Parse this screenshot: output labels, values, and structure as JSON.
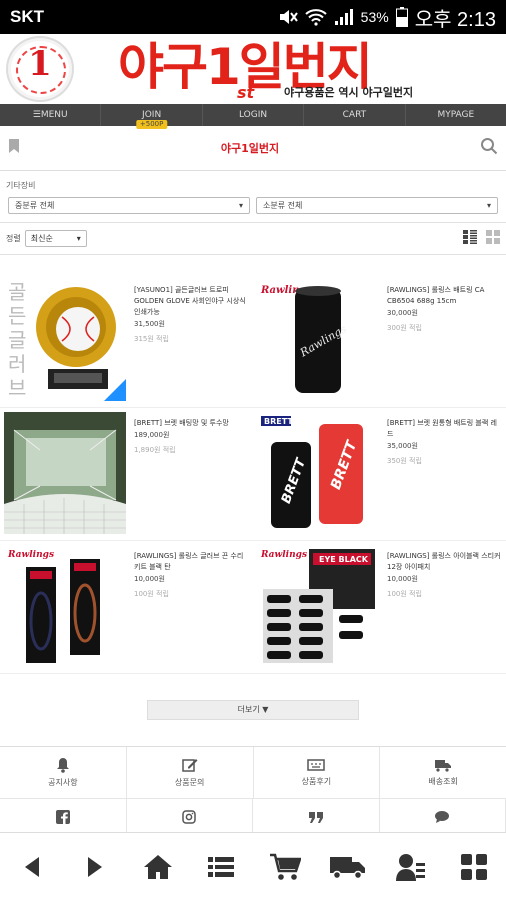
{
  "status_bar": {
    "carrier": "SKT",
    "battery_percent": "53%",
    "time": "오후 2:13"
  },
  "banner": {
    "logo_number": "1",
    "brand_text": "야구1일번지",
    "brand_superscript": "st",
    "slogan": "야구용품은 역시 야구일번지"
  },
  "nav": {
    "menu": "☰MENU",
    "join": "JOIN",
    "join_badge": "+500P",
    "login": "LOGIN",
    "cart": "CART",
    "mypage": "MYPAGE"
  },
  "subhead": {
    "logo_text": "야구1일번지"
  },
  "breadcrumb": "기타장비",
  "filters": {
    "category_medium": "중분류 전체",
    "category_small": "소분류 전체"
  },
  "sort": {
    "label": "정렬",
    "selected": "최신순"
  },
  "products": [
    {
      "name": "[YASUNO1] 골든글러브 트로피 GOLDEN GLOVE 사회인야구 시상식 인쇄가능",
      "price": "31,500원",
      "points": "315원 적립",
      "thumb_type": "trophy",
      "thumb_text": "골든 글러브"
    },
    {
      "name": "[RAWLINGS] 롤링스 배트링 CA CB6504 688g 15cm",
      "price": "30,000원",
      "points": "300원 적립",
      "thumb_type": "batweight",
      "thumb_text": "Rawlings"
    },
    {
      "name": "[BRETT] 브렛 배팅망 및 투수망",
      "price": "189,000원",
      "points": "1,890원 적립",
      "thumb_type": "net",
      "thumb_text": ""
    },
    {
      "name": "[BRETT] 브렛 원통형 배트링 블랙 레드",
      "price": "35,000원",
      "points": "350원 적립",
      "thumb_type": "brett",
      "thumb_text": "BRETT"
    },
    {
      "name": "[RAWLINGS] 롤링스 글러브 끈 수리키트 블랙 탄",
      "price": "10,000원",
      "points": "100원 적립",
      "thumb_type": "laces",
      "thumb_text": "Rawlings"
    },
    {
      "name": "[RAWLINGS] 롤링스 아이블랙 스티커 12장 아이패치",
      "price": "10,000원",
      "points": "100원 적립",
      "thumb_type": "eyeblack",
      "thumb_text": "EYE BLACK"
    }
  ],
  "more_button": "더보기 ▼",
  "footer": {
    "notice": "공지사항",
    "inquiry": "상품문의",
    "review": "상품후기",
    "delivery": "배송조회"
  },
  "colors": {
    "brand_red": "#e2231a",
    "nav_bg": "#444444",
    "join_badge": "#f2c01c"
  }
}
